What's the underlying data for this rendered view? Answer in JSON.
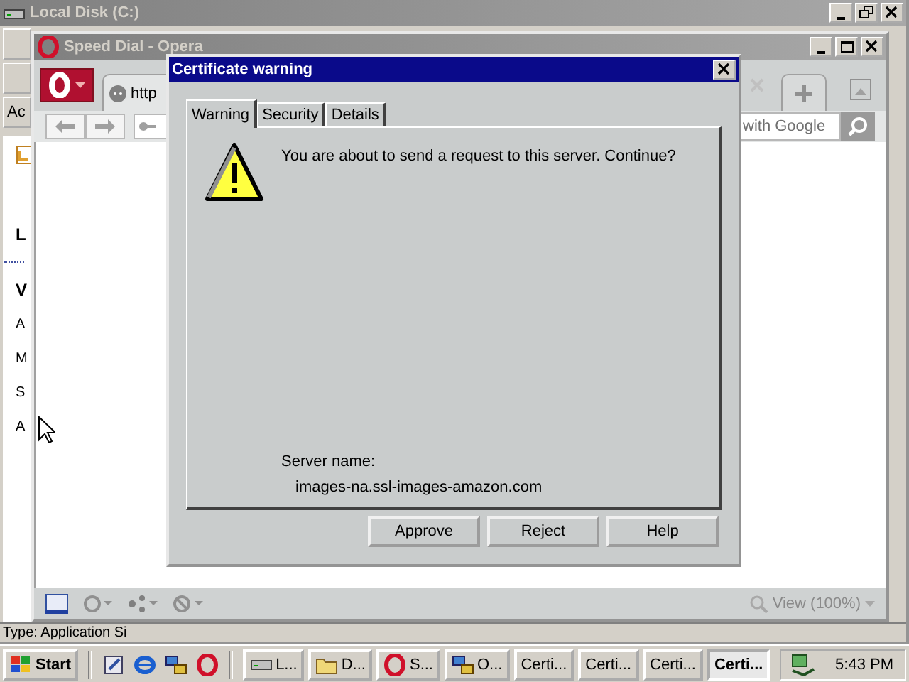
{
  "explorer": {
    "title": "Local Disk (C:)",
    "address_label": "Ac",
    "pane_items": [
      {
        "text": "L",
        "bold": true
      },
      {
        "text": "V",
        "bold": true
      },
      {
        "text": "A",
        "bold": false
      },
      {
        "text": "M",
        "bold": false
      },
      {
        "text": "S",
        "bold": false
      },
      {
        "text": "A",
        "bold": false
      }
    ],
    "status": "Type: Application Si"
  },
  "browser": {
    "title": "Speed Dial - Opera",
    "tab": {
      "label": "http"
    },
    "search": {
      "placeholder": "with Google"
    },
    "zoom": "View (100%)"
  },
  "dialog": {
    "title": "Certificate warning",
    "tabs": [
      {
        "label": "Warning",
        "selected": true
      },
      {
        "label": "Security",
        "selected": false
      },
      {
        "label": "Details",
        "selected": false
      }
    ],
    "message": "You are about to send a request to this server. Continue?",
    "server_label": "Server name:",
    "server": "images-na.ssl-images-amazon.com",
    "buttons": [
      "Approve",
      "Reject",
      "Help"
    ]
  },
  "taskbar": {
    "start": "Start",
    "tasks": [
      {
        "label": "L...",
        "kind": "drive",
        "selected": false
      },
      {
        "label": "D...",
        "kind": "folder",
        "selected": false
      },
      {
        "label": "S...",
        "kind": "opera",
        "selected": false
      },
      {
        "label": "O...",
        "kind": "network",
        "selected": false
      },
      {
        "label": "Certi...",
        "kind": "plain",
        "selected": false
      },
      {
        "label": "Certi...",
        "kind": "plain",
        "selected": false
      },
      {
        "label": "Certi...",
        "kind": "plain",
        "selected": false
      },
      {
        "label": "Certi...",
        "kind": "plain",
        "selected": true
      }
    ],
    "clock": "5:43 PM"
  }
}
